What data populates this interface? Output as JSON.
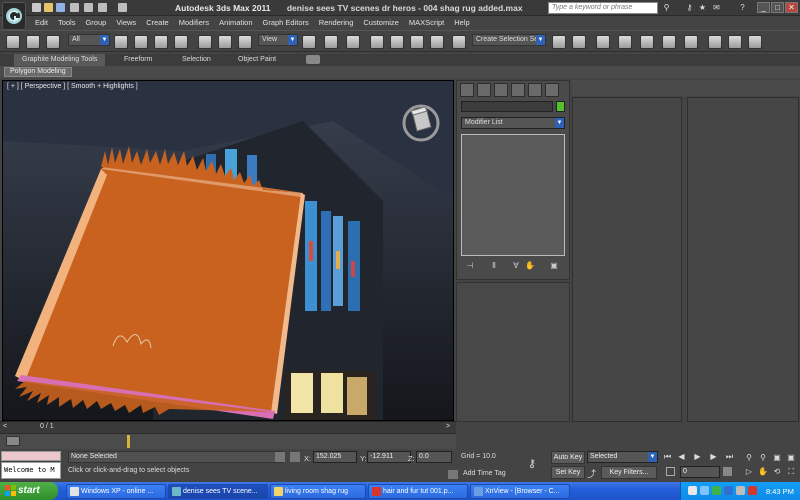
{
  "window": {
    "app_title": "Autodesk 3ds Max  2011",
    "doc_title": "denise sees TV scenes dr heros - 004 shag rug added.max",
    "search_placeholder": "Type a keyword or phrase",
    "minimize": "_",
    "maximize": "□",
    "close": "✕"
  },
  "menu": [
    "Edit",
    "Tools",
    "Group",
    "Views",
    "Create",
    "Modifiers",
    "Animation",
    "Graph Editors",
    "Rendering",
    "Customize",
    "MAXScript",
    "Help"
  ],
  "toolbar": {
    "filter_value": "All",
    "refcoord_value": "View",
    "selection_set_value": "Create Selection Se"
  },
  "ribbon": {
    "tabs": [
      "Graphite Modeling Tools",
      "Freeform",
      "Selection",
      "Object Paint"
    ],
    "panel_label": "Polygon Modeling"
  },
  "viewport": {
    "label": "[ + ] [ Perspective ] [ Smooth + Highlights ]"
  },
  "command_panel": {
    "modifier_list": "Modifier List"
  },
  "timeline": {
    "frame_label": "0 / 1"
  },
  "status": {
    "welcome": "Welcome to M",
    "selection": "None Selected",
    "prompt": "Click or click-and-drag to select objects",
    "x_label": "X:",
    "x_value": "152.025",
    "y_label": "Y:",
    "y_value": "-12.911",
    "z_label": "Z:",
    "z_value": "0.0",
    "grid": "Grid = 10.0",
    "add_time_tag": "Add Time Tag",
    "auto_key": "Auto Key",
    "set_key": "Set Key",
    "selected_dd": "Selected",
    "key_filters": "Key Filters...",
    "frame": "0"
  },
  "taskbar": {
    "start": "start",
    "tasks": [
      "Windows XP - online ...",
      "denise sees TV scene...",
      "living room shag rug",
      "hair and fur tut 001.p...",
      "XnView - [Browser - C..."
    ],
    "clock": "8:43 PM"
  }
}
